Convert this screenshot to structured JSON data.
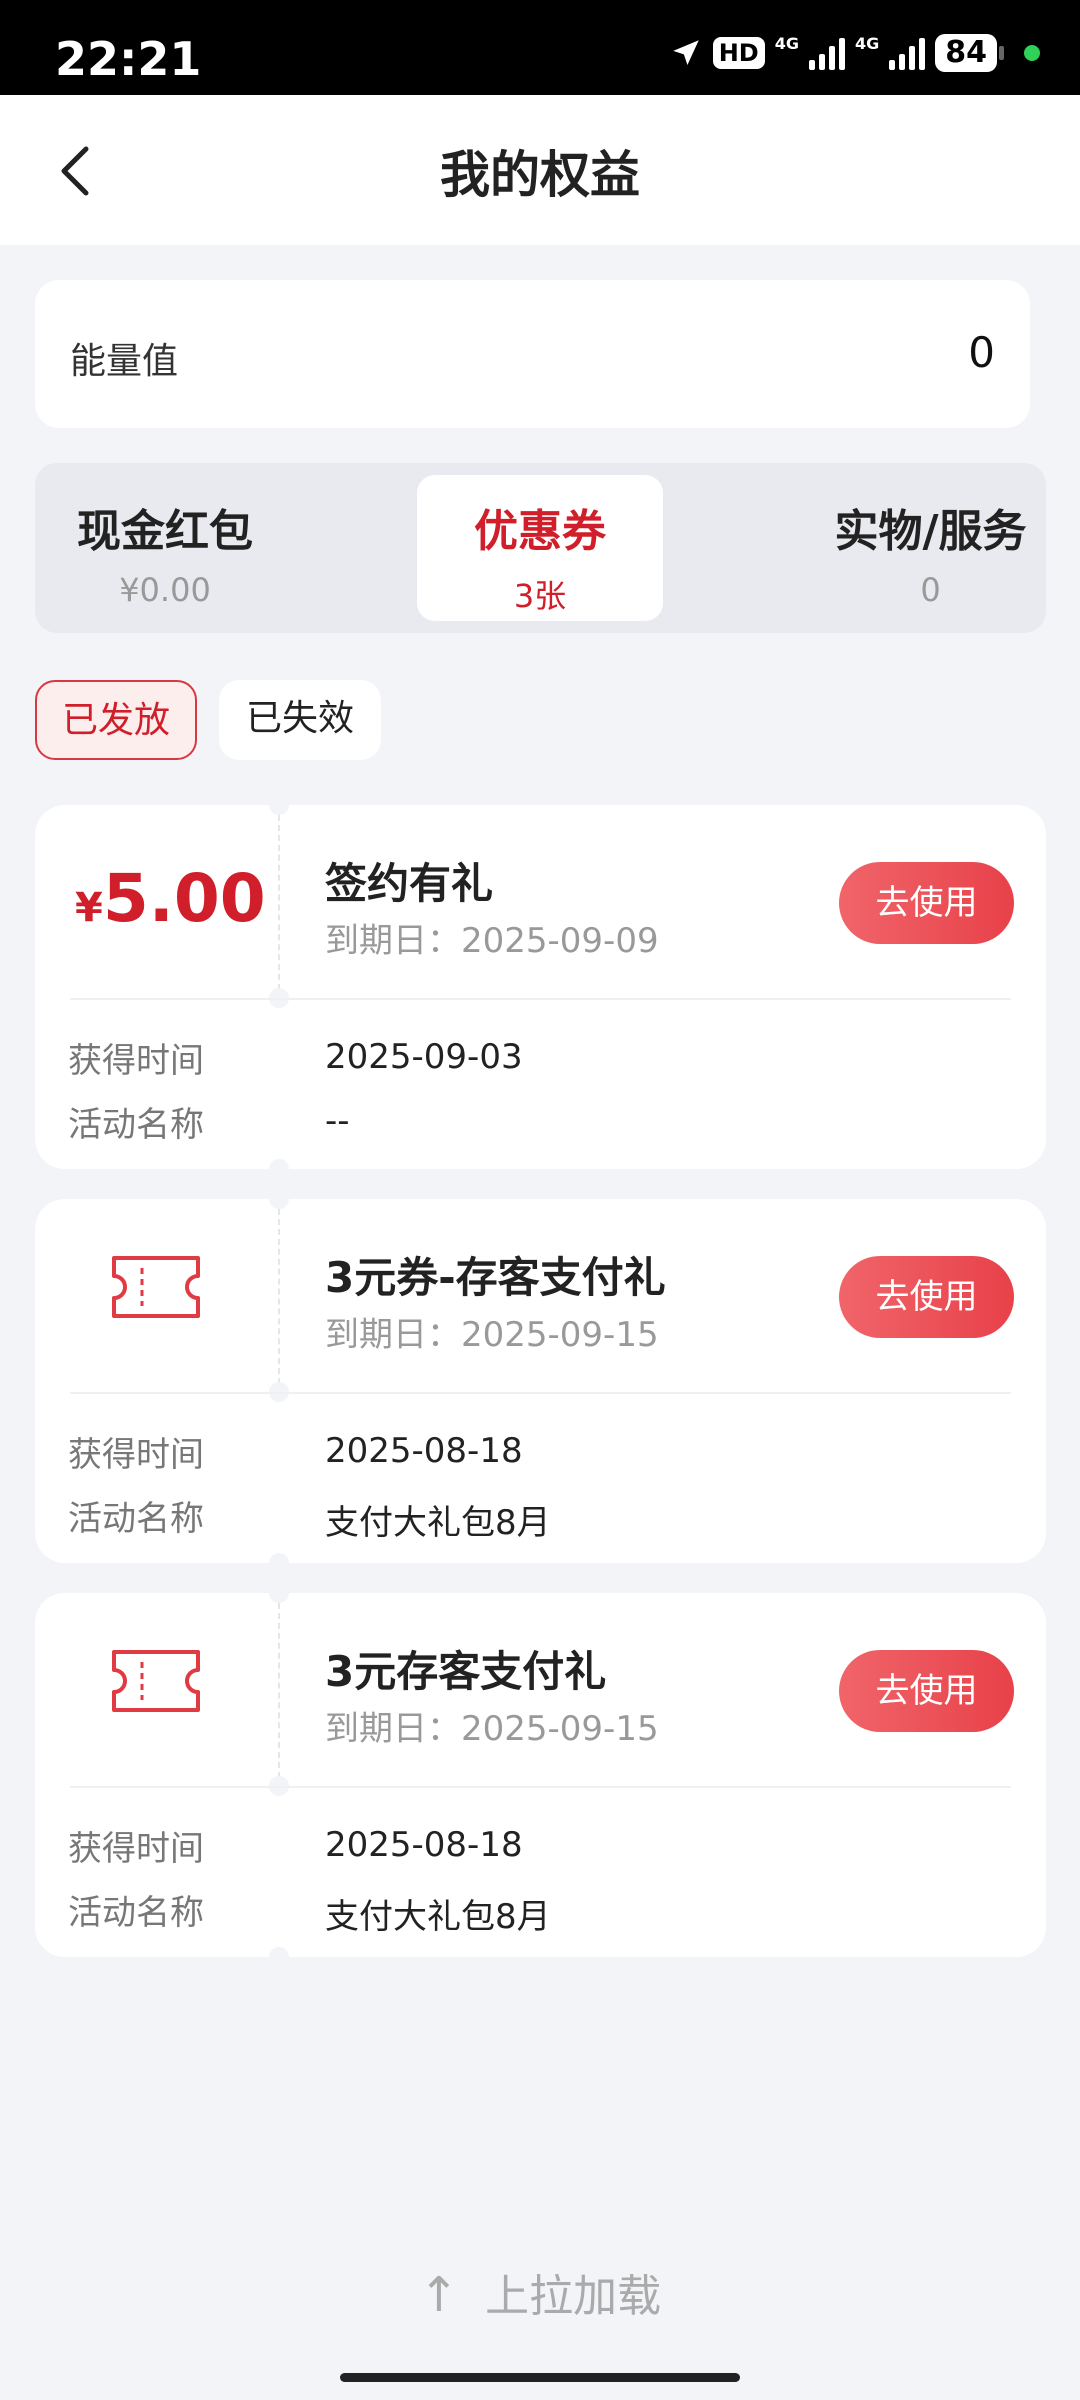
{
  "status_bar": {
    "time": "22:21",
    "hd": "HD",
    "net1": "4G",
    "net2": "4G",
    "battery": "84"
  },
  "header": {
    "title": "我的权益",
    "back_icon": "chevron-left-icon"
  },
  "energy": {
    "label": "能量值",
    "value": "0"
  },
  "category_tabs": [
    {
      "label": "现金红包",
      "sub": "¥0.00",
      "active": false
    },
    {
      "label": "优惠券",
      "sub": "3张",
      "active": true
    },
    {
      "label": "实物/服务",
      "sub": "0",
      "active": false
    }
  ],
  "filters": [
    {
      "label": "已发放",
      "active": true
    },
    {
      "label": "已失效",
      "active": false
    }
  ],
  "coupons": [
    {
      "amount_symbol": "¥",
      "amount": "5.00",
      "name": "签约有礼",
      "expiry": "到期日：2025-09-09",
      "button": "去使用",
      "obtained_label": "获得时间",
      "obtained_value": "2025-09-03",
      "activity_label": "活动名称",
      "activity_value": "--"
    },
    {
      "icon": "ticket-icon",
      "name": "3元券-存客支付礼",
      "expiry": "到期日：2025-09-15",
      "button": "去使用",
      "obtained_label": "获得时间",
      "obtained_value": "2025-08-18",
      "activity_label": "活动名称",
      "activity_value": "支付大礼包8月"
    },
    {
      "icon": "ticket-icon",
      "name": "3元存客支付礼",
      "expiry": "到期日：2025-09-15",
      "button": "去使用",
      "obtained_label": "获得时间",
      "obtained_value": "2025-08-18",
      "activity_label": "活动名称",
      "activity_value": "支付大礼包8月"
    }
  ],
  "footer": {
    "pull_up": "上拉加载",
    "arrow_icon": "arrow-up-icon"
  },
  "colors": {
    "accent": "#d01f2a",
    "button": "#ec5057",
    "background": "#f3f4f8"
  }
}
